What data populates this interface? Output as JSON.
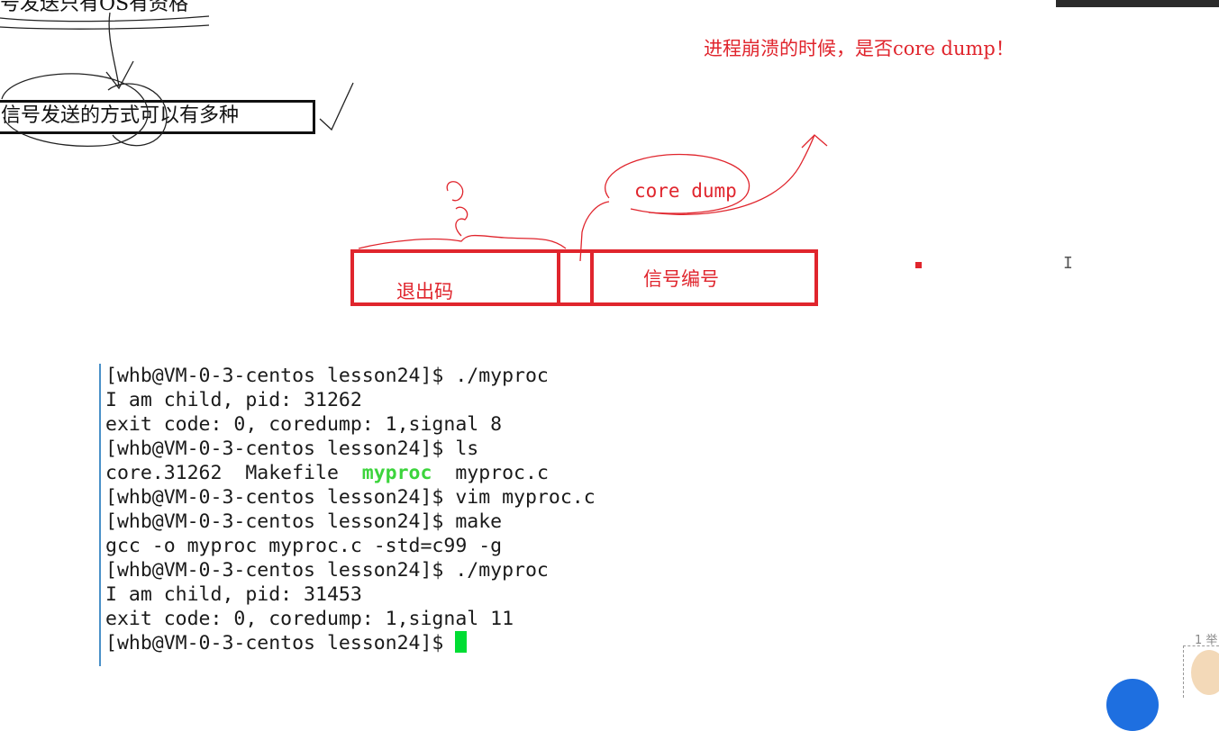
{
  "annotations": {
    "title_note": "号发送只有OS有资格",
    "method_box": "信号发送的方式可以有多种",
    "red_note": "进程崩溃的时候，是否core dump！",
    "core_dump_label": "core dump",
    "exit_code_label": "退出码",
    "signal_label": "信号编号"
  },
  "terminal": {
    "line1": "[whb@VM-0-3-centos lesson24]$ ./myproc",
    "line2": "I am child, pid: 31262",
    "line3": "exit code: 0, coredump: 1,signal 8",
    "line4": "[whb@VM-0-3-centos lesson24]$ ls",
    "line5_part1": "core.31262  Makefile  ",
    "line5_exe": "myproc",
    "line5_part2": "  myproc.c",
    "line6": "[whb@VM-0-3-centos lesson24]$ vim myproc.c",
    "line7": "[whb@VM-0-3-centos lesson24]$ make",
    "line8": "gcc -o myproc myproc.c -std=c99 -g",
    "line9": "[whb@VM-0-3-centos lesson24]$ ./myproc",
    "line10": "I am child, pid: 31453",
    "line11": "exit code: 0, coredump: 1,signal 11",
    "line12": "[whb@VM-0-3-centos lesson24]$ "
  },
  "overlay": {
    "raise_count": "1 举"
  },
  "colors": {
    "annotation_red": "#e0252d",
    "executable_green": "#3cd43c",
    "cursor_green": "#00dd33",
    "terminal_border": "#4a90c8"
  }
}
